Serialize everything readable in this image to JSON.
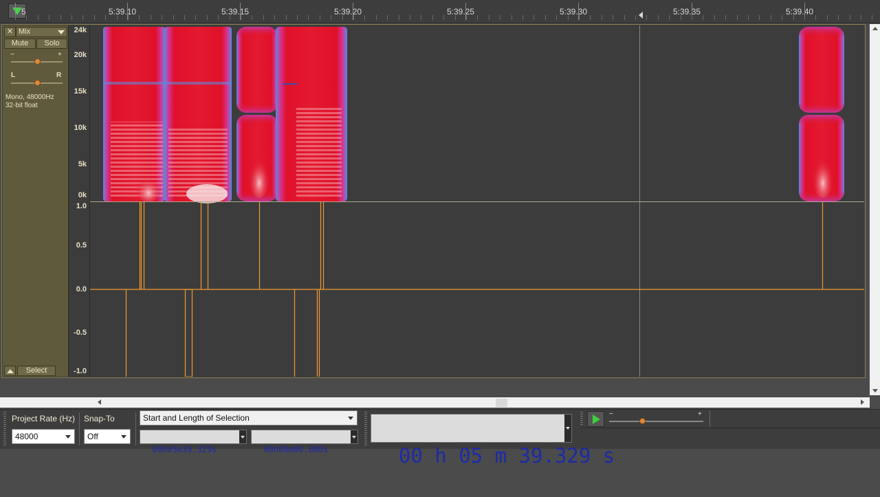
{
  "ruler": {
    "labels": [
      "5:39.10",
      "5:39.15",
      "5:39.20",
      "5:39.25",
      "5:39.30",
      "5:39.35",
      "5:39.40"
    ],
    "left_cut_label": "5"
  },
  "track": {
    "name": "Mix",
    "mute_label": "Mute",
    "solo_label": "Solo",
    "gain_minus": "−",
    "gain_plus": "+",
    "pan_left": "L",
    "pan_right": "R",
    "info_line1": "Mono, 48000Hz",
    "info_line2": "32-bit float",
    "select_label": "Select",
    "gain_level": 0.5,
    "pan_level": 0.5
  },
  "spectrogram_scale": [
    "24k",
    "20k",
    "15k",
    "10k",
    "5k",
    "0k"
  ],
  "waveform_scale": [
    "1.0",
    "0.5",
    "0.0",
    "-0.5",
    "-1.0"
  ],
  "bottom": {
    "project_rate_label": "Project Rate (Hz)",
    "project_rate_value": "48000",
    "snap_to_label": "Snap-To",
    "snap_to_value": "Off",
    "selection_mode": "Start and Length of Selection",
    "selection_start": "00h05m39.329s",
    "selection_length": "00h00m00.000s",
    "big_time": "00 h 05 m 39.329 s",
    "playback_minus": "−",
    "playback_plus": "+",
    "playback_speed_level": 0.35
  },
  "colors": {
    "waveform": "#f09a30",
    "spectrogram_hot": "#e0102a",
    "spectrogram_edge": "#5a8ae0",
    "background_dark": "#3c3c3c",
    "track_panel": "#5f5a3c",
    "timecode_text": "#1d2aa8"
  },
  "icons": {
    "play_head": "green-down-triangle-icon",
    "close_track": "close-icon",
    "track_menu": "chevron-down-icon",
    "collapse": "chevron-up-icon",
    "play": "play-icon"
  }
}
